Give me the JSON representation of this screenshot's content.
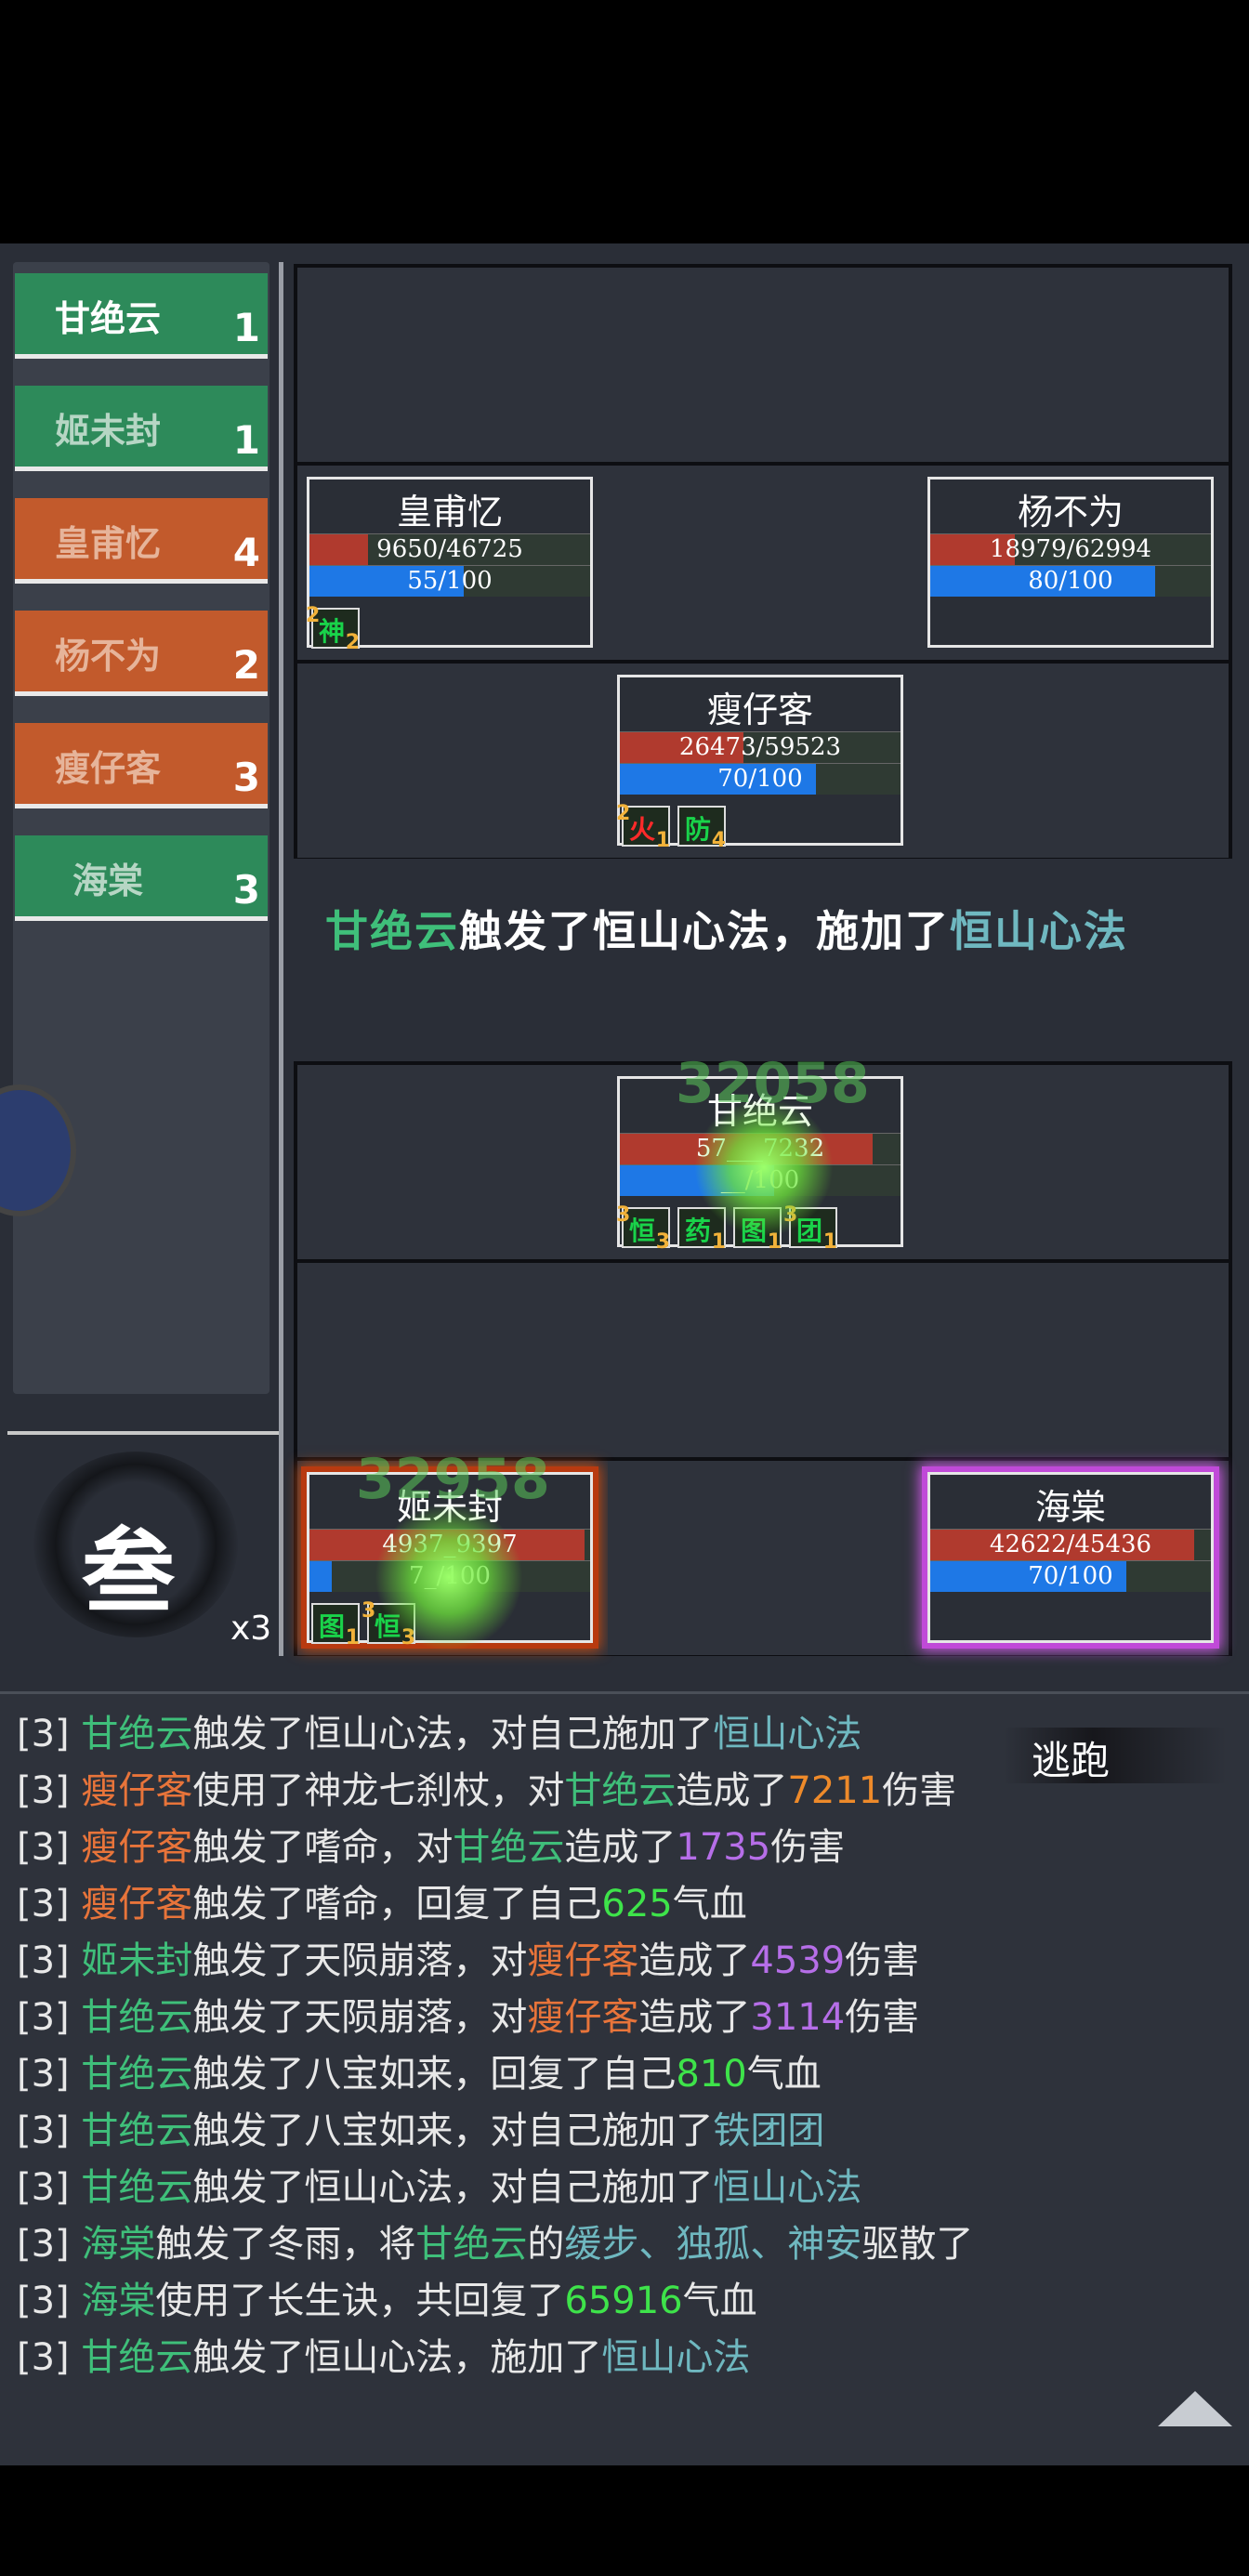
{
  "turn_order": [
    {
      "name": "甘绝云",
      "count": "1",
      "team": "ally"
    },
    {
      "name": "姬未封",
      "count": "1",
      "team": "ally"
    },
    {
      "name": "皇甫忆",
      "count": "4",
      "team": "enemy"
    },
    {
      "name": "杨不为",
      "count": "2",
      "team": "enemy"
    },
    {
      "name": "瘦仔客",
      "count": "3",
      "team": "enemy"
    },
    {
      "name": "海棠",
      "count": "3",
      "team": "ally"
    }
  ],
  "enemies": {
    "huangfu": {
      "name": "皇甫忆",
      "hp": "9650/46725",
      "hp_frac": 0.206,
      "mp": "55/100",
      "mp_frac": 0.55,
      "buffs": [
        {
          "glyph": "神",
          "stack": "2",
          "num": "2"
        }
      ]
    },
    "yang": {
      "name": "杨不为",
      "hp": "18979/62994",
      "hp_frac": 0.301,
      "mp": "80/100",
      "mp_frac": 0.8
    },
    "shou": {
      "name": "瘦仔客",
      "hp": "26473/59523",
      "hp_frac": 0.445,
      "mp": "70/100",
      "mp_frac": 0.7,
      "buffs": [
        {
          "glyph": "火",
          "stack": "2",
          "num": "1"
        },
        {
          "glyph": "防",
          "stack": "",
          "num": "4"
        }
      ]
    }
  },
  "message": {
    "actor": "甘绝云",
    "mid": "触发了恒山心法，施加了",
    "skill": "恒山心法"
  },
  "allies": {
    "gan": {
      "name": "甘绝云",
      "hp": "57___7232",
      "hp_frac": 0.9,
      "mp": "__/100",
      "mp_frac": 0.55,
      "float": "32058",
      "buffs": [
        {
          "glyph": "恒",
          "stack": "3",
          "num": "3"
        },
        {
          "glyph": "药",
          "stack": "",
          "num": "1"
        },
        {
          "glyph": "图",
          "stack": "",
          "num": "1"
        },
        {
          "glyph": "团",
          "stack": "3",
          "num": "1"
        }
      ]
    },
    "ji": {
      "name": "姬未封",
      "hp": "4937_9397",
      "hp_frac": 0.98,
      "mp": "7_/100",
      "mp_frac": 0.08,
      "float": "32958",
      "buffs": [
        {
          "glyph": "图",
          "stack": "",
          "num": "1"
        },
        {
          "glyph": "恒",
          "stack": "3",
          "num": "3"
        }
      ]
    },
    "hai": {
      "name": "海棠",
      "hp": "42622/45436",
      "hp_frac": 0.938,
      "mp": "70/100",
      "mp_frac": 0.7
    }
  },
  "round_badge": {
    "glyph": "叁",
    "mult": "x3"
  },
  "flee_label": "逃跑",
  "colors": {
    "ally": "#3fbf7a",
    "enemy": "#e8743a",
    "skill": "#6fb8c0",
    "heal": "#3ee34a"
  },
  "log": [
    [
      {
        "t": "[3] "
      },
      {
        "t": "甘绝云",
        "c": "c-g"
      },
      {
        "t": "触发了恒山心法，对自己施加了"
      },
      {
        "t": "恒山心法",
        "c": "c-t"
      }
    ],
    [
      {
        "t": "[3] "
      },
      {
        "t": "瘦仔客",
        "c": "c-o"
      },
      {
        "t": "使用了神龙七刹杖，对"
      },
      {
        "t": "甘绝云",
        "c": "c-g"
      },
      {
        "t": "造成了"
      },
      {
        "t": "7211",
        "c": "c-y"
      },
      {
        "t": "伤害"
      }
    ],
    [
      {
        "t": "[3] "
      },
      {
        "t": "瘦仔客",
        "c": "c-o"
      },
      {
        "t": "触发了嗜命，对"
      },
      {
        "t": "甘绝云",
        "c": "c-g"
      },
      {
        "t": "造成了"
      },
      {
        "t": "1735",
        "c": "c-p"
      },
      {
        "t": "伤害"
      }
    ],
    [
      {
        "t": "[3] "
      },
      {
        "t": "瘦仔客",
        "c": "c-o"
      },
      {
        "t": "触发了嗜命，回复了自己"
      },
      {
        "t": "625",
        "c": "c-lg"
      },
      {
        "t": "气血"
      }
    ],
    [
      {
        "t": "[3] "
      },
      {
        "t": "姬未封",
        "c": "c-g"
      },
      {
        "t": "触发了天陨崩落，对"
      },
      {
        "t": "瘦仔客",
        "c": "c-o"
      },
      {
        "t": "造成了"
      },
      {
        "t": "4539",
        "c": "c-p"
      },
      {
        "t": "伤害"
      }
    ],
    [
      {
        "t": "[3] "
      },
      {
        "t": "甘绝云",
        "c": "c-g"
      },
      {
        "t": "触发了天陨崩落，对"
      },
      {
        "t": "瘦仔客",
        "c": "c-o"
      },
      {
        "t": "造成了"
      },
      {
        "t": "3114",
        "c": "c-p"
      },
      {
        "t": "伤害"
      }
    ],
    [
      {
        "t": "[3] "
      },
      {
        "t": "甘绝云",
        "c": "c-g"
      },
      {
        "t": "触发了八宝如来，回复了自己"
      },
      {
        "t": "810",
        "c": "c-lg"
      },
      {
        "t": "气血"
      }
    ],
    [
      {
        "t": "[3] "
      },
      {
        "t": "甘绝云",
        "c": "c-g"
      },
      {
        "t": "触发了八宝如来，对自己施加了"
      },
      {
        "t": "铁团团",
        "c": "c-t"
      }
    ],
    [
      {
        "t": "[3] "
      },
      {
        "t": "甘绝云",
        "c": "c-g"
      },
      {
        "t": "触发了恒山心法，对自己施加了"
      },
      {
        "t": "恒山心法",
        "c": "c-t"
      }
    ],
    [
      {
        "t": "[3] "
      },
      {
        "t": "海棠",
        "c": "c-g"
      },
      {
        "t": "触发了冬雨，将"
      },
      {
        "t": "甘绝云",
        "c": "c-g"
      },
      {
        "t": "的"
      },
      {
        "t": "缓步、独孤、神安",
        "c": "c-t"
      },
      {
        "t": "驱散了"
      }
    ],
    [
      {
        "t": "[3] "
      },
      {
        "t": "海棠",
        "c": "c-g"
      },
      {
        "t": "使用了长生诀，共回复了"
      },
      {
        "t": "65916",
        "c": "c-lg"
      },
      {
        "t": "气血"
      }
    ],
    [
      {
        "t": "[3] "
      },
      {
        "t": "甘绝云",
        "c": "c-g"
      },
      {
        "t": "触发了恒山心法，施加了"
      },
      {
        "t": "恒山心法",
        "c": "c-t"
      }
    ]
  ]
}
